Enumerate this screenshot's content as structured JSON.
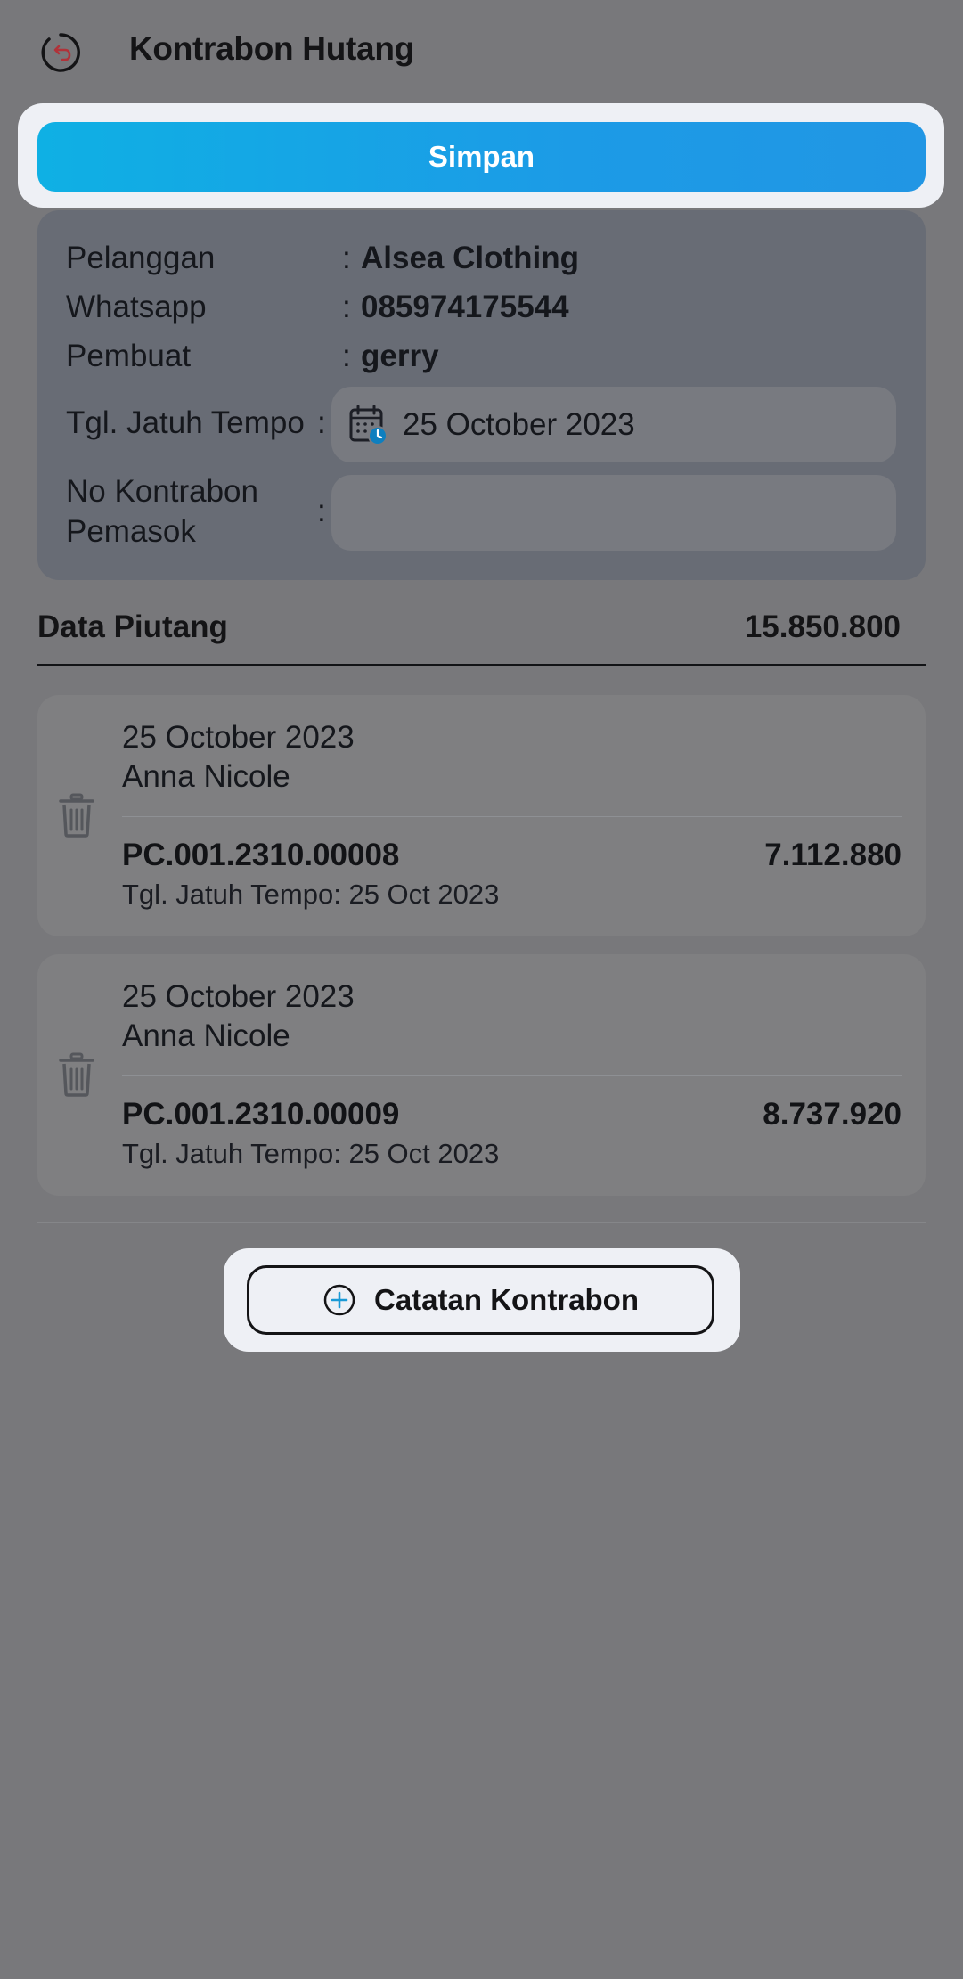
{
  "header": {
    "title": "Kontrabon Hutang",
    "back_icon": "back-arrow-circle-icon"
  },
  "actions": {
    "save_label": "Simpan",
    "add_label": "Catatan Kontrabon"
  },
  "info": {
    "pelanggan_label": "Pelanggan",
    "pelanggan_value": "Alsea Clothing",
    "whatsapp_label": "Whatsapp",
    "whatsapp_value": "085974175544",
    "pembuat_label": "Pembuat",
    "pembuat_value": "gerry",
    "jatuh_tempo_label": "Tgl. Jatuh Tempo",
    "jatuh_tempo_value": "25 October 2023",
    "no_kontrabon_label_1": "No Kontrabon",
    "no_kontrabon_label_2": "Pemasok",
    "no_kontrabon_value": "",
    "colon": ":"
  },
  "section": {
    "title": "Data Piutang",
    "total": "15.850.800"
  },
  "entries": [
    {
      "date": "25 October 2023",
      "name": "Anna Nicole",
      "code": "PC.001.2310.00008",
      "amount": "7.112.880",
      "due": "Tgl. Jatuh Tempo: 25 Oct 2023"
    },
    {
      "date": "25 October 2023",
      "name": "Anna Nicole",
      "code": "PC.001.2310.00009",
      "amount": "8.737.920",
      "due": "Tgl. Jatuh Tempo: 25 Oct 2023"
    }
  ],
  "colors": {
    "background": "#78787b",
    "accent_gradient_start": "#0fb0e4",
    "accent_gradient_end": "#2196e4",
    "back_icon_arrow": "#b0333a"
  }
}
